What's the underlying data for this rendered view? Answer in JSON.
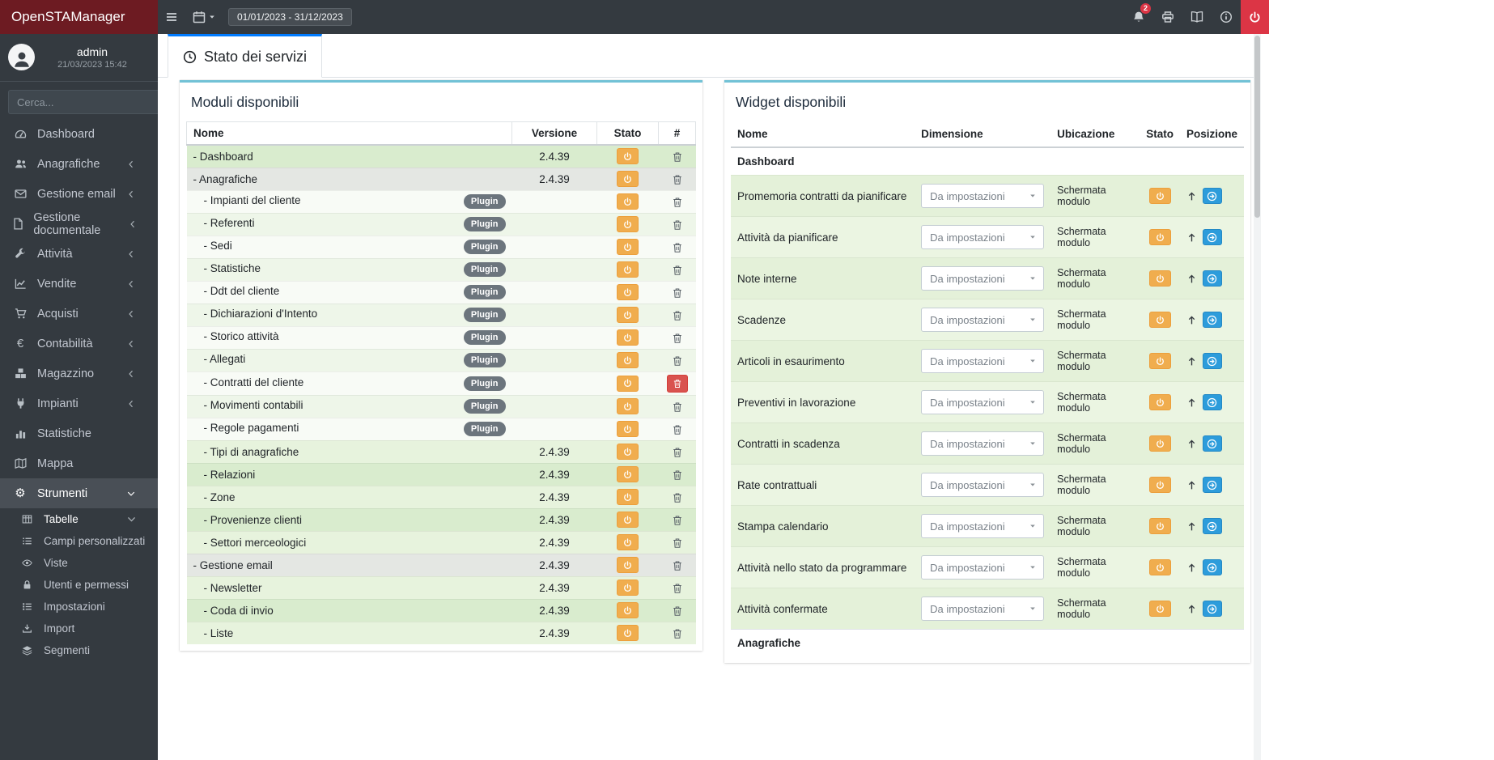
{
  "colors": {
    "brand_bg": "#6d1b22",
    "topbar_bg": "#343a40",
    "sidebar_bg": "#343a40",
    "danger_red": "#dc3545",
    "warning_orange": "#f0ad4e",
    "move_blue": "#2d9cdb",
    "tab_accent_blue": "#007bff",
    "card_accent_cyan": "#72c2d6",
    "row_green": "#d9ecce"
  },
  "topbar": {
    "brand": "OpenSTAManager",
    "date_range": "01/01/2023 - 31/12/2023",
    "notification_count": "2"
  },
  "sidebar": {
    "user": {
      "name": "admin",
      "last_login": "21/03/2023 15:42"
    },
    "search": {
      "placeholder": "Cerca..."
    },
    "items": [
      {
        "label": "Dashboard",
        "icon": "tachometer-icon",
        "chevron": ""
      },
      {
        "label": "Anagrafiche",
        "icon": "users-icon",
        "chevron": "left"
      },
      {
        "label": "Gestione email",
        "icon": "envelope-icon",
        "chevron": "left"
      },
      {
        "label": "Gestione documentale",
        "icon": "file-icon",
        "chevron": "left"
      },
      {
        "label": "Attività",
        "icon": "wrench-icon",
        "chevron": "left"
      },
      {
        "label": "Vendite",
        "icon": "chart-line-icon",
        "chevron": "left"
      },
      {
        "label": "Acquisti",
        "icon": "cart-icon",
        "chevron": "left"
      },
      {
        "label": "Contabilità",
        "icon": "euro-icon",
        "chevron": "left"
      },
      {
        "label": "Magazzino",
        "icon": "boxes-icon",
        "chevron": "left"
      },
      {
        "label": "Impianti",
        "icon": "plug-icon",
        "chevron": "left"
      },
      {
        "label": "Statistiche",
        "icon": "bar-chart-icon",
        "chevron": ""
      },
      {
        "label": "Mappa",
        "icon": "map-icon",
        "chevron": ""
      },
      {
        "label": "Strumenti",
        "icon": "gear-icon",
        "chevron": "down",
        "active": true
      }
    ],
    "tools_children": [
      {
        "label": "Tabelle",
        "icon": "table-icon",
        "chevron": "down",
        "open": true
      },
      {
        "label": "Campi personalizzati",
        "icon": "list-icon",
        "chevron": ""
      },
      {
        "label": "Viste",
        "icon": "eye-icon",
        "chevron": ""
      },
      {
        "label": "Utenti e permessi",
        "icon": "lock-icon",
        "chevron": ""
      },
      {
        "label": "Impostazioni",
        "icon": "settings-list-icon",
        "chevron": ""
      },
      {
        "label": "Import",
        "icon": "import-icon",
        "chevron": ""
      },
      {
        "label": "Segmenti",
        "icon": "segments-icon",
        "chevron": ""
      }
    ]
  },
  "tabs": {
    "active": {
      "label": "Stato dei servizi",
      "icon": "clock-icon"
    }
  },
  "modules_panel": {
    "title": "Moduli disponibili",
    "columns": [
      "Nome",
      "Versione",
      "Stato",
      "#"
    ],
    "plugin_badge": "Plugin",
    "rows": [
      {
        "name": "- Dashboard",
        "version": "2.4.39",
        "plugin": false,
        "indent": 0,
        "tone": "g1",
        "delete": "icon"
      },
      {
        "name": "- Anagrafiche",
        "version": "2.4.39",
        "plugin": false,
        "indent": 0,
        "tone": "gray",
        "delete": "icon"
      },
      {
        "name": "- Impianti del cliente",
        "version": "",
        "plugin": true,
        "indent": 1,
        "tone": "pb",
        "delete": "icon"
      },
      {
        "name": "- Referenti",
        "version": "",
        "plugin": true,
        "indent": 1,
        "tone": "pa",
        "delete": "icon"
      },
      {
        "name": "- Sedi",
        "version": "",
        "plugin": true,
        "indent": 1,
        "tone": "pb",
        "delete": "icon"
      },
      {
        "name": "- Statistiche",
        "version": "",
        "plugin": true,
        "indent": 1,
        "tone": "pa",
        "delete": "icon"
      },
      {
        "name": "- Ddt del cliente",
        "version": "",
        "plugin": true,
        "indent": 1,
        "tone": "pb",
        "delete": "icon"
      },
      {
        "name": "- Dichiarazioni d'Intento",
        "version": "",
        "plugin": true,
        "indent": 1,
        "tone": "pa",
        "delete": "icon"
      },
      {
        "name": "- Storico attività",
        "version": "",
        "plugin": true,
        "indent": 1,
        "tone": "pb",
        "delete": "icon"
      },
      {
        "name": "- Allegati",
        "version": "",
        "plugin": true,
        "indent": 1,
        "tone": "pa",
        "delete": "icon"
      },
      {
        "name": "- Contratti del cliente",
        "version": "",
        "plugin": true,
        "indent": 1,
        "tone": "pb",
        "delete": "danger"
      },
      {
        "name": "- Movimenti contabili",
        "version": "",
        "plugin": true,
        "indent": 1,
        "tone": "pa",
        "delete": "icon"
      },
      {
        "name": "- Regole pagamenti",
        "version": "",
        "plugin": true,
        "indent": 1,
        "tone": "pb",
        "delete": "icon"
      },
      {
        "name": "- Tipi di anagrafiche",
        "version": "2.4.39",
        "plugin": false,
        "indent": 1,
        "tone": "g2",
        "delete": "icon"
      },
      {
        "name": "- Relazioni",
        "version": "2.4.39",
        "plugin": false,
        "indent": 1,
        "tone": "g1",
        "delete": "icon"
      },
      {
        "name": "- Zone",
        "version": "2.4.39",
        "plugin": false,
        "indent": 1,
        "tone": "g2",
        "delete": "icon"
      },
      {
        "name": "- Provenienze clienti",
        "version": "2.4.39",
        "plugin": false,
        "indent": 1,
        "tone": "g1",
        "delete": "icon"
      },
      {
        "name": "- Settori merceologici",
        "version": "2.4.39",
        "plugin": false,
        "indent": 1,
        "tone": "g2",
        "delete": "icon"
      },
      {
        "name": "- Gestione email",
        "version": "2.4.39",
        "plugin": false,
        "indent": 0,
        "tone": "gray",
        "delete": "icon"
      },
      {
        "name": "- Newsletter",
        "version": "2.4.39",
        "plugin": false,
        "indent": 1,
        "tone": "g2",
        "delete": "icon"
      },
      {
        "name": "- Coda di invio",
        "version": "2.4.39",
        "plugin": false,
        "indent": 1,
        "tone": "g1",
        "delete": "icon"
      },
      {
        "name": "- Liste",
        "version": "2.4.39",
        "plugin": false,
        "indent": 1,
        "tone": "g2",
        "delete": "icon"
      }
    ]
  },
  "widgets_panel": {
    "title": "Widget disponibili",
    "columns": [
      "Nome",
      "Dimensione",
      "Ubicazione",
      "Stato",
      "Posizione"
    ],
    "sections": [
      {
        "heading": "Dashboard",
        "widgets": [
          {
            "name": "Promemoria contratti da pianificare",
            "dimension": "Da impostazioni",
            "location": "Schermata modulo"
          },
          {
            "name": "Attività da pianificare",
            "dimension": "Da impostazioni",
            "location": "Schermata modulo"
          },
          {
            "name": "Note interne",
            "dimension": "Da impostazioni",
            "location": "Schermata modulo"
          },
          {
            "name": "Scadenze",
            "dimension": "Da impostazioni",
            "location": "Schermata modulo"
          },
          {
            "name": "Articoli in esaurimento",
            "dimension": "Da impostazioni",
            "location": "Schermata modulo"
          },
          {
            "name": "Preventivi in lavorazione",
            "dimension": "Da impostazioni",
            "location": "Schermata modulo"
          },
          {
            "name": "Contratti in scadenza",
            "dimension": "Da impostazioni",
            "location": "Schermata modulo"
          },
          {
            "name": "Rate contrattuali",
            "dimension": "Da impostazioni",
            "location": "Schermata modulo"
          },
          {
            "name": "Stampa calendario",
            "dimension": "Da impostazioni",
            "location": "Schermata modulo"
          },
          {
            "name": "Attività nello stato da programmare",
            "dimension": "Da impostazioni",
            "location": "Schermata modulo"
          },
          {
            "name": "Attività confermate",
            "dimension": "Da impostazioni",
            "location": "Schermata modulo"
          }
        ]
      },
      {
        "heading": "Anagrafiche",
        "widgets": []
      }
    ]
  }
}
